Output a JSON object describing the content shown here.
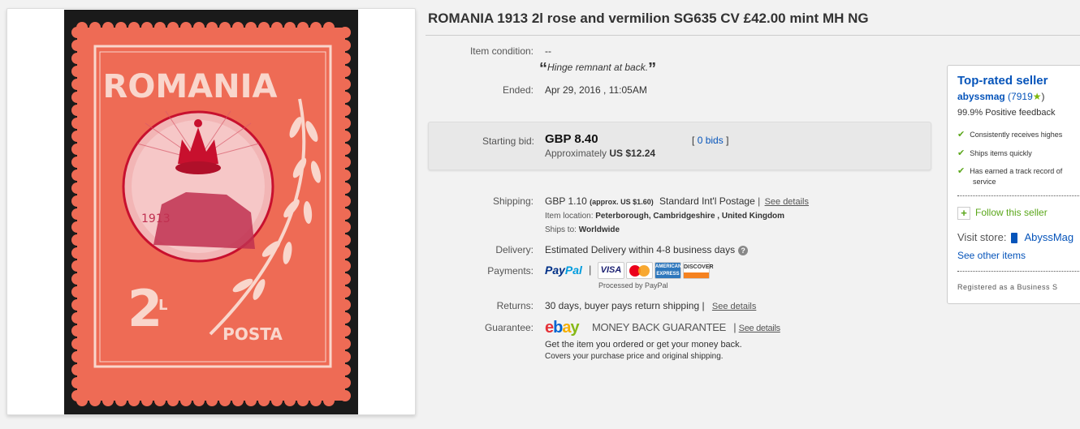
{
  "listing": {
    "title": "ROMANIA 1913 2l rose and vermilion SG635 CV £42.00 mint MH NG",
    "condition_label": "Item condition:",
    "condition_value": "--",
    "condition_note": "Hinge remnant at back.",
    "quote_open": "“",
    "quote_close": "”",
    "ended_label": "Ended:",
    "ended_value": "Apr 29, 2016 , 11:05AM"
  },
  "stamp": {
    "country": "ROMANIA",
    "year": "1913",
    "value": "2",
    "value_suffix": "L",
    "posta": "POSTA",
    "colors": {
      "paper": "#ee6b55",
      "light": "#f9d6cc",
      "dark": "#c8102e"
    }
  },
  "bid": {
    "label": "Starting bid:",
    "price": "GBP 8.40",
    "approx_prefix": "Approximately",
    "approx_value": "US $12.24",
    "bids_open": "[",
    "bids_link": "0 bids",
    "bids_close": "]"
  },
  "shipping": {
    "label": "Shipping:",
    "price": "GBP 1.10",
    "approx": "(approx. US $1.60)",
    "method": "Standard Int'l Postage",
    "see_details": "See details",
    "location_label": "Item location:",
    "location_value": "Peterborough, Cambridgeshire , United Kingdom",
    "ships_label": "Ships to:",
    "ships_value": "Worldwide"
  },
  "delivery": {
    "label": "Delivery:",
    "value": "Estimated Delivery within 4-8 business days",
    "info_icon": "info-icon"
  },
  "payments": {
    "label": "Payments:",
    "paypal_a": "Pay",
    "paypal_b": "Pal",
    "separator": "|",
    "cards": [
      "VISA",
      "mastercard",
      "AMERICAN EXPRESS",
      "DISCOVER"
    ],
    "processed": "Processed by PayPal"
  },
  "returns": {
    "label": "Returns:",
    "value": "30 days, buyer pays return shipping |",
    "see_details": "See details"
  },
  "guarantee": {
    "label": "Guarantee:",
    "logo": [
      "e",
      "b",
      "a",
      "y"
    ],
    "mbg": "MONEY BACK GUARANTEE",
    "separator": "|",
    "see_details": "See details",
    "line1": "Get the item you ordered or get your money back.",
    "line2": "Covers your purchase price and original shipping."
  },
  "seller": {
    "heading": "Top-rated seller",
    "name": "abyssmag",
    "score": "(7919",
    "star": "★",
    "score_close": ")",
    "feedback": "99.9% Positive feedback",
    "checks": [
      "Consistently receives highes",
      "Ships items quickly",
      "Has earned a track record of",
      "service"
    ],
    "follow": "Follow this seller",
    "follow_icon": "+",
    "visit_label": "Visit store:",
    "store_name": "AbyssMag",
    "other_items": "See other items",
    "registered": "Registered as a Business S"
  }
}
